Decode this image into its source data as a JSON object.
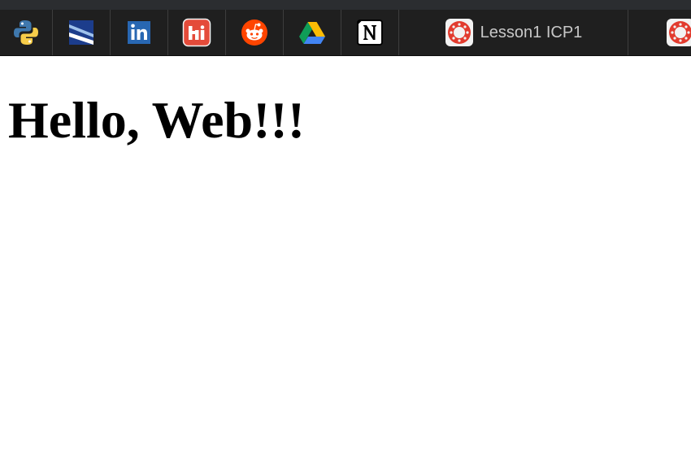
{
  "browser": {
    "pinned_tabs": [
      {
        "icon": "python-icon"
      },
      {
        "icon": "blue-diagonal-logo-icon"
      },
      {
        "icon": "linkedin-icon"
      },
      {
        "icon": "handshake-icon"
      },
      {
        "icon": "reddit-icon"
      },
      {
        "icon": "google-drive-icon"
      },
      {
        "icon": "notion-icon"
      }
    ],
    "active_tab": {
      "title": "Lesson1 ICP1",
      "icon": "canvas-icon"
    },
    "next_tab": {
      "icon": "canvas-icon"
    }
  },
  "page": {
    "heading": "Hello, Web!!!"
  },
  "colors": {
    "tabbar": "#1f1f1f",
    "tab_text": "#c8c8c8",
    "canvas_red": "#e23b2e"
  }
}
